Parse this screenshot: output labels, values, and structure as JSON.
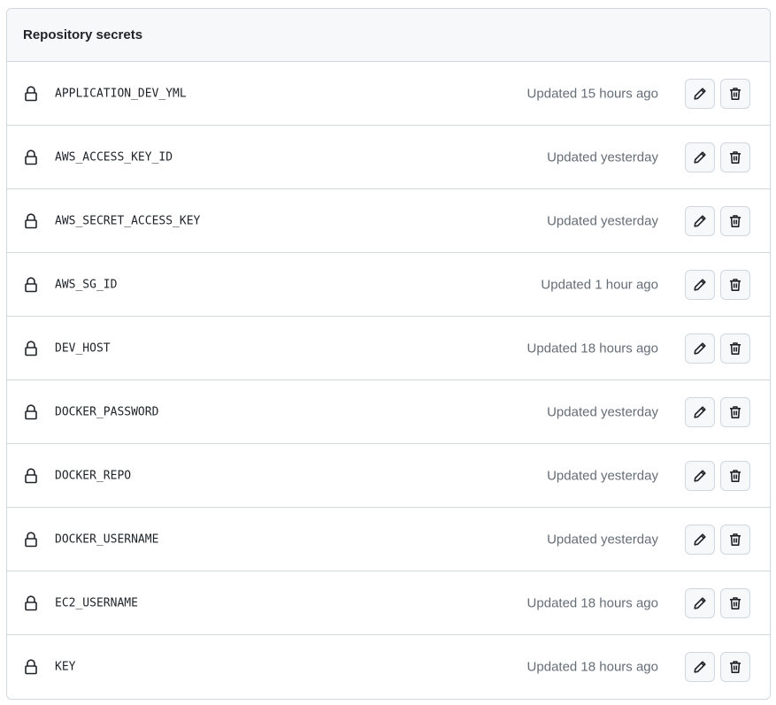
{
  "header": {
    "title": "Repository secrets"
  },
  "secrets": [
    {
      "name": "APPLICATION_DEV_YML",
      "updated": "Updated 15 hours ago"
    },
    {
      "name": "AWS_ACCESS_KEY_ID",
      "updated": "Updated yesterday"
    },
    {
      "name": "AWS_SECRET_ACCESS_KEY",
      "updated": "Updated yesterday"
    },
    {
      "name": "AWS_SG_ID",
      "updated": "Updated 1 hour ago"
    },
    {
      "name": "DEV_HOST",
      "updated": "Updated 18 hours ago"
    },
    {
      "name": "DOCKER_PASSWORD",
      "updated": "Updated yesterday"
    },
    {
      "name": "DOCKER_REPO",
      "updated": "Updated yesterday"
    },
    {
      "name": "DOCKER_USERNAME",
      "updated": "Updated yesterday"
    },
    {
      "name": "EC2_USERNAME",
      "updated": "Updated 18 hours ago"
    },
    {
      "name": "KEY",
      "updated": "Updated 18 hours ago"
    }
  ],
  "icons": {
    "secret": "lock-icon",
    "edit": "pencil-icon",
    "delete": "trash-icon"
  },
  "colors": {
    "text": "#1f2328",
    "muted": "#656d76",
    "border": "#d0d7de",
    "header_bg": "#f6f8fa"
  }
}
